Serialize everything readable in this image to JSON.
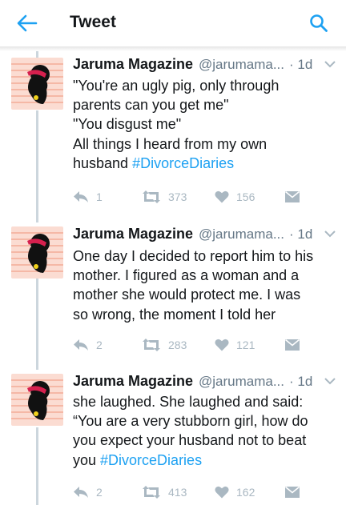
{
  "header": {
    "title": "Tweet",
    "back_icon": "arrow-left-icon",
    "search_icon": "search-icon",
    "accent_color": "#1da1f2"
  },
  "tweets": [
    {
      "name": "Jaruma Magazine",
      "handle": "@jarumama...",
      "time": "· 1d",
      "text_lines": [
        {
          "text": "\"You're an ugly pig, only through"
        },
        {
          "text": "parents can you get me\""
        },
        {
          "text": "\"You disgust me\""
        },
        {
          "text": "All things I heard from my own"
        },
        {
          "text": "husband ",
          "hashtag": "#DivorceDiaries"
        }
      ],
      "replies": "1",
      "retweets": "373",
      "likes": "156"
    },
    {
      "name": "Jaruma Magazine",
      "handle": "@jarumama...",
      "time": "· 1d",
      "text_lines": [
        {
          "text": "One day I decided to report him to his"
        },
        {
          "text": "mother. I figured as a woman and a"
        },
        {
          "text": "mother she would protect me. I was"
        },
        {
          "text": "so wrong, the moment I told her"
        }
      ],
      "replies": "2",
      "retweets": "283",
      "likes": "121"
    },
    {
      "name": "Jaruma Magazine",
      "handle": "@jarumama...",
      "time": "· 1d",
      "text_lines": [
        {
          "text": "she laughed. She laughed and said:"
        },
        {
          "text": "“You are a very stubborn girl, how do"
        },
        {
          "text": "you expect your husband not to beat"
        },
        {
          "text": "you ",
          "hashtag": "#DivorceDiaries"
        }
      ],
      "replies": "2",
      "retweets": "413",
      "likes": "162"
    }
  ]
}
